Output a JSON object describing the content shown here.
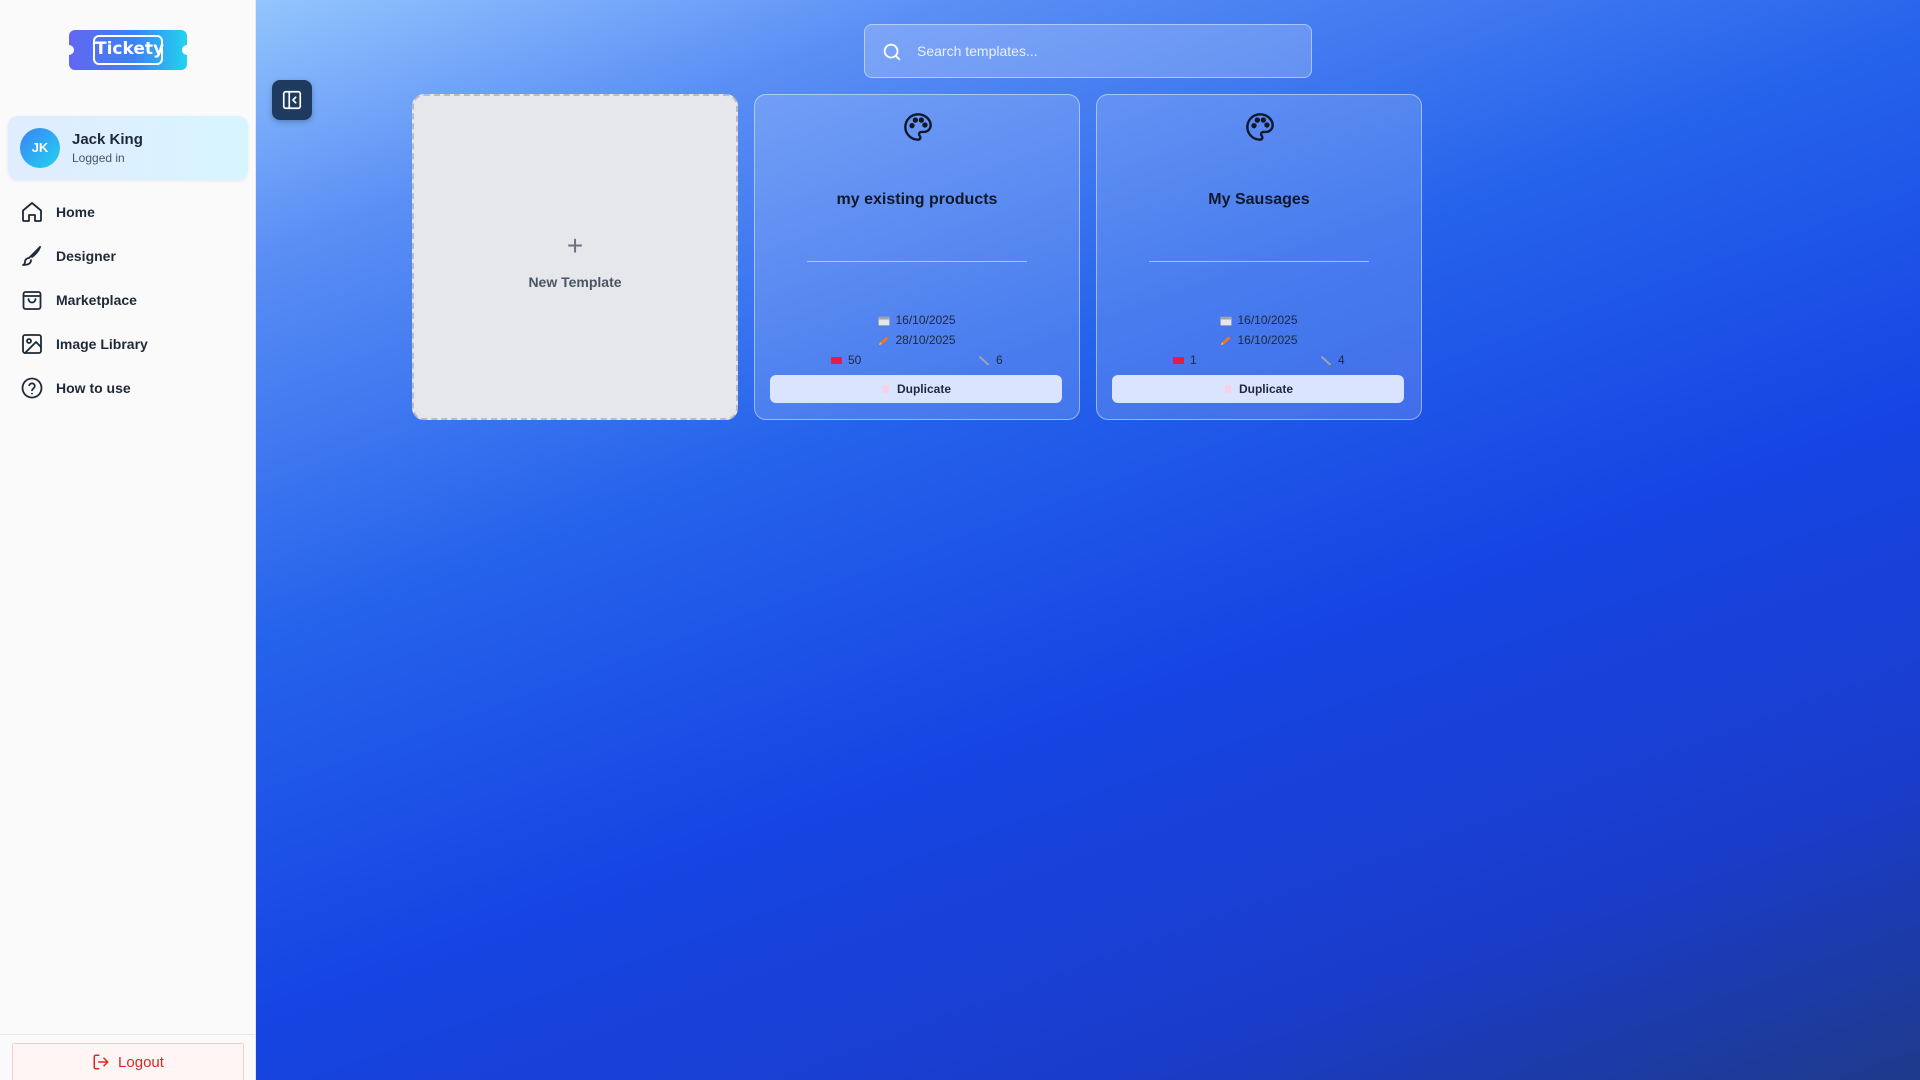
{
  "brand": {
    "logo_text": "Tickety"
  },
  "user": {
    "initials": "JK",
    "name": "Jack King",
    "status": "Logged in"
  },
  "nav": {
    "items": [
      {
        "label": "Home",
        "icon": "home-icon"
      },
      {
        "label": "Designer",
        "icon": "brush-icon"
      },
      {
        "label": "Marketplace",
        "icon": "shopping-bag-icon"
      },
      {
        "label": "Image Library",
        "icon": "image-icon"
      },
      {
        "label": "How to use",
        "icon": "help-circle-icon"
      }
    ]
  },
  "logout": {
    "label": "Logout",
    "icon": "logout-icon"
  },
  "search": {
    "placeholder": "Search templates...",
    "value": ""
  },
  "new_template": {
    "plus": "+",
    "label": "New Template"
  },
  "templates": [
    {
      "title": "my existing products",
      "created": "16/10/2025",
      "edited": "28/10/2025",
      "tickets": "50",
      "elements": "6",
      "duplicate_label": "Duplicate"
    },
    {
      "title": "My Sausages",
      "created": "16/10/2025",
      "edited": "16/10/2025",
      "tickets": "1",
      "elements": "4",
      "duplicate_label": "Duplicate"
    }
  ],
  "colors": {
    "accent": "#2563eb",
    "logout": "#dc2626",
    "background_start": "#93c5fd",
    "background_end": "#1e3a8a"
  }
}
